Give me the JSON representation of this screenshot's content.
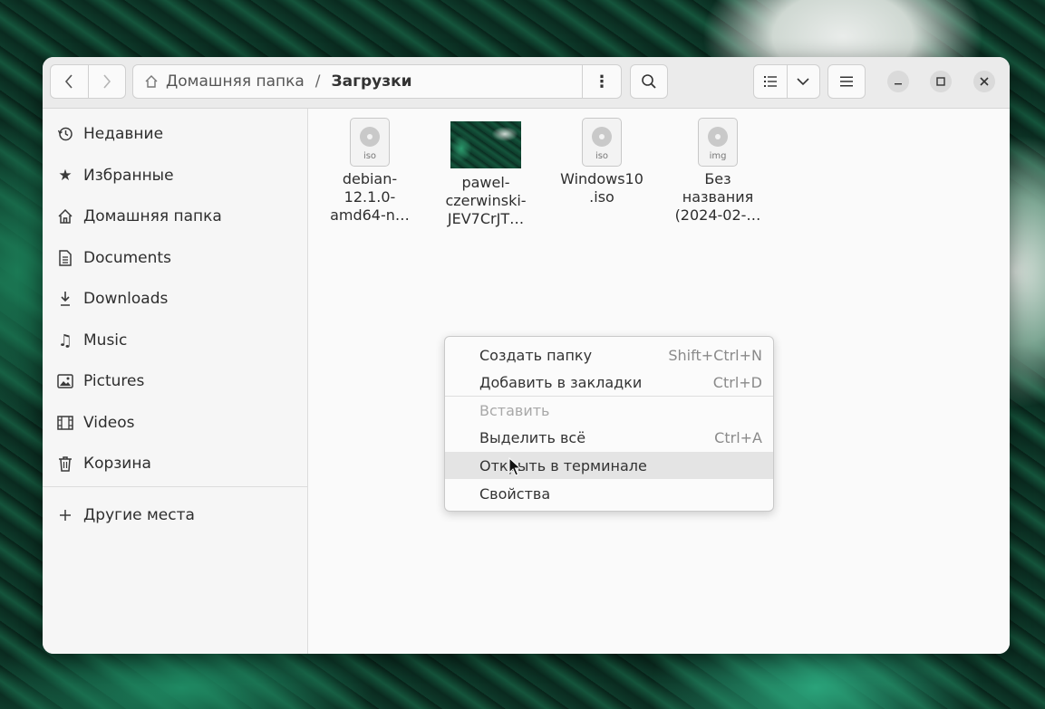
{
  "window": {
    "path": {
      "root": "Домашняя папка",
      "separator": "/",
      "current": "Загрузки"
    }
  },
  "toolbar": {
    "back_icon": "chevron-left-icon",
    "forward_icon": "chevron-right-icon",
    "path_menu_icon": "vertical-dots-icon",
    "search_icon": "search-icon",
    "view_list_icon": "list-view-icon",
    "view_options_icon": "chevron-down-icon",
    "main_menu_icon": "hamburger-icon"
  },
  "sidebar": {
    "items": [
      {
        "label": "Недавние",
        "icon": "clock-icon"
      },
      {
        "label": "Избранные",
        "icon": "star-icon"
      },
      {
        "label": "Домашняя папка",
        "icon": "home-icon"
      },
      {
        "label": "Documents",
        "icon": "document-icon"
      },
      {
        "label": "Downloads",
        "icon": "download-icon"
      },
      {
        "label": "Music",
        "icon": "music-icon"
      },
      {
        "label": "Pictures",
        "icon": "picture-icon"
      },
      {
        "label": "Videos",
        "icon": "film-icon"
      },
      {
        "label": "Корзина",
        "icon": "trash-icon"
      }
    ],
    "other": {
      "label": "Другие места",
      "icon": "plus-icon"
    }
  },
  "files": [
    {
      "lines": [
        "debian-",
        "12.1.0-",
        "amd64-n…"
      ],
      "type": "iso"
    },
    {
      "lines": [
        "pawel-",
        "czerwinski-",
        "JEV7CrJT…"
      ],
      "type": "image"
    },
    {
      "lines": [
        "Windows10",
        ".iso"
      ],
      "type": "iso"
    },
    {
      "lines": [
        "Без",
        "названия",
        "(2024-02-…"
      ],
      "type": "img"
    }
  ],
  "context_menu": {
    "items": [
      {
        "label": "Создать папку",
        "accel": "Shift+Ctrl+N"
      },
      {
        "label": "Добавить в закладки",
        "accel": "Ctrl+D"
      },
      {
        "label": "Вставить",
        "accel": ""
      },
      {
        "label": "Выделить всё",
        "accel": "Ctrl+A"
      },
      {
        "label": "Открыть в терминале",
        "accel": ""
      },
      {
        "label": "Свойства",
        "accel": ""
      }
    ]
  }
}
